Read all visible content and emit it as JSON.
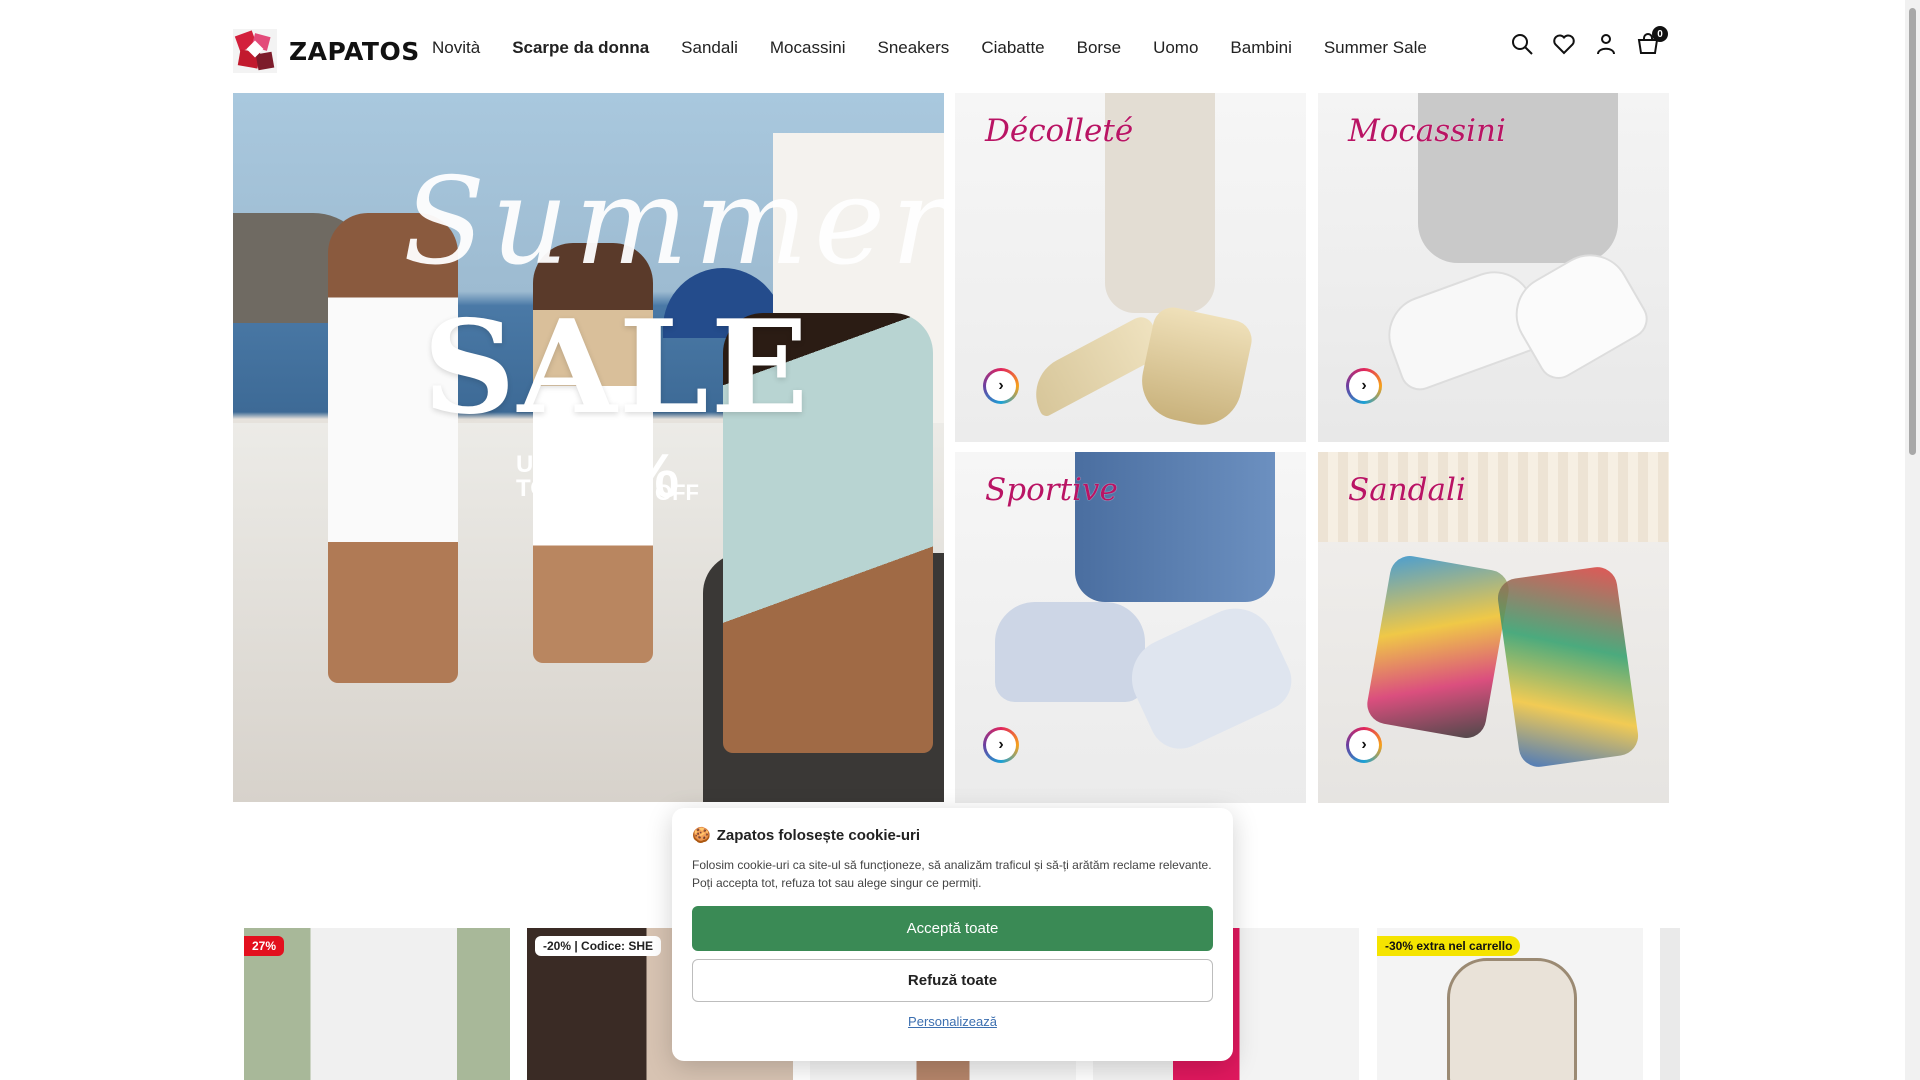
{
  "header": {
    "logo_text": "ZAPATOS",
    "nav": [
      "Novità",
      "Scarpe da donna",
      "Sandali",
      "Mocassini",
      "Sneakers",
      "Ciabatte",
      "Borse",
      "Uomo",
      "Bambini",
      "Summer Sale"
    ],
    "active_nav": "Scarpe da donna",
    "icons": [
      "search-icon",
      "heart-icon",
      "user-icon",
      "cart-icon"
    ],
    "cart_count": "0"
  },
  "hero": {
    "script_text": "Summer",
    "sale_text": "SALE",
    "up_to_line1": "UP",
    "up_to_line2": "TO",
    "percent": "65%",
    "off": "OFF"
  },
  "categories": [
    {
      "label": "Décolleté"
    },
    {
      "label": "Mocassini"
    },
    {
      "label": "Sportive"
    },
    {
      "label": "Sandali"
    }
  ],
  "products": [
    {
      "badge": "27%",
      "badge_color": "#e3101e"
    },
    {
      "badge": "-20% | Codice: SHE",
      "badge_color": "#ffffff"
    },
    {
      "badge": "",
      "badge_color": ""
    },
    {
      "badge": "",
      "badge_color": ""
    },
    {
      "badge": "-30% extra nel carrello",
      "badge_color": "#f5e400"
    }
  ],
  "cookie": {
    "icon": "cookie-icon",
    "title": "Zapatos folosește cookie-uri",
    "text": "Folosim cookie-uri ca site-ul să funcționeze, să analizăm traficul și să-ți arătăm reclame relevante. Poți accepta tot, refuza tot sau alege singur ce permiți.",
    "accept": "Acceptă toate",
    "refuse": "Refuză toate",
    "customize": "Personalizează"
  },
  "colors": {
    "accept_button": "#3a8a55",
    "category_label": "#b91464",
    "link": "#3c6fb0"
  }
}
